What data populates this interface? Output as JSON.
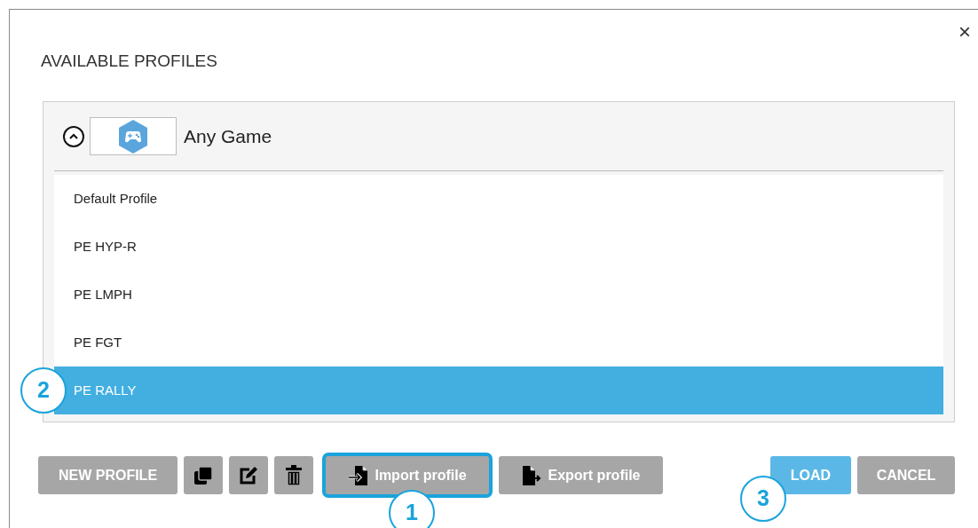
{
  "dialog": {
    "title": "AVAILABLE PROFILES",
    "close": "×"
  },
  "game_group": {
    "name": "Any Game",
    "expanded": true
  },
  "profiles": [
    {
      "name": "Default Profile",
      "selected": false
    },
    {
      "name": "PE HYP-R",
      "selected": false
    },
    {
      "name": "PE LMPH",
      "selected": false
    },
    {
      "name": "PE FGT",
      "selected": false
    },
    {
      "name": "PE RALLY",
      "selected": true,
      "callout": "2"
    }
  ],
  "toolbar": [
    {
      "kind": "text",
      "label": "NEW PROFILE"
    },
    {
      "kind": "copy"
    },
    {
      "kind": "edit"
    },
    {
      "kind": "delete"
    },
    {
      "kind": "import",
      "label": "Import profile",
      "highlighted": true,
      "callout": "1"
    },
    {
      "kind": "export",
      "label": "Export profile",
      "highlighted": false
    }
  ],
  "actions": [
    {
      "kind": "primary",
      "label": "LOAD",
      "callout": "3"
    },
    {
      "kind": "secondary",
      "label": "CANCEL"
    }
  ]
}
